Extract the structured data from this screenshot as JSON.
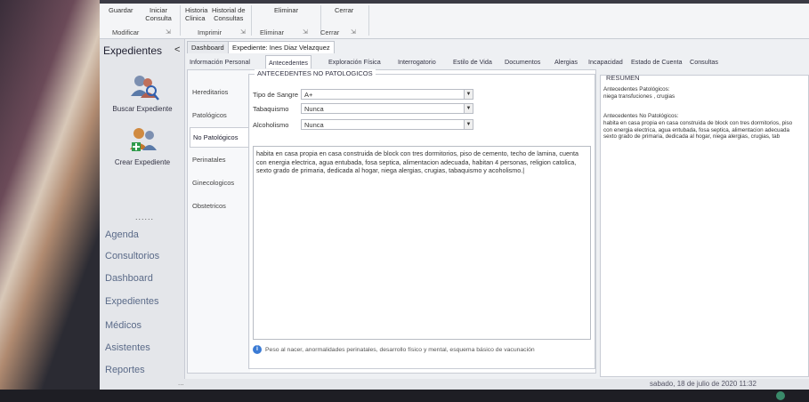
{
  "ribbon": {
    "buttons": [
      {
        "label": "Guardar"
      },
      {
        "label": "Iniciar\nConsulta"
      },
      {
        "label": "Historia\nClinica"
      },
      {
        "label": "Historial de\nConsultas"
      },
      {
        "label": "Eliminar"
      },
      {
        "label": "Cerrar"
      }
    ],
    "group_labels": [
      "Modificar",
      "Imprimir",
      "Eliminar",
      "Cerrar"
    ]
  },
  "sidebar": {
    "title": "Expedientes",
    "collapse_glyph": "<",
    "actions": [
      {
        "label": "Buscar Expediente",
        "icon": "search-users-icon"
      },
      {
        "label": "Crear Expediente",
        "icon": "add-user-icon"
      }
    ],
    "dots": "......",
    "nav": [
      "Agenda",
      "Consultorios",
      "Dashboard",
      "Expedientes",
      "Médicos",
      "Asistentes",
      "Reportes"
    ]
  },
  "doc_tabs": [
    "Dashboard",
    "Expediente: Ines Diaz Velazquez"
  ],
  "sub_tabs": [
    "Información Personal",
    "Antecedentes",
    "Exploración Física",
    "Interrogatorio",
    "Estilo de Vida",
    "Documentos",
    "Alergias",
    "Incapacidad",
    "Estado de Cuenta",
    "Consultas"
  ],
  "sections": [
    "Hereditarios",
    "Patológicos",
    "No Patológicos",
    "Perinatales",
    "Ginecologicos",
    "Obstetricos"
  ],
  "form": {
    "group_title": "ANTECEDENTES NO PATOLOGICOS",
    "fields": [
      {
        "label": "Tipo de Sangre",
        "value": "A+"
      },
      {
        "label": "Tabaquismo",
        "value": "Nunca"
      },
      {
        "label": "Alcoholismo",
        "value": "Nunca"
      }
    ],
    "notes": "habita en casa propia en casa construida de block con tres dormitorios, piso de cemento, techo de lamina, cuenta con energia electrica, agua entubada, fosa septica, alimentacion adecuada, habitan 4 personas, religion catolica, sexto grado de primaria, dedicada al hogar, niega alergias, crugias, tabaquismo y acoholismo.|",
    "hint": "Peso al nacer, anormalidades perinatales, desarrollo físico y mental, esquema básico de vacunación"
  },
  "resumen": {
    "title": "RESUMEN",
    "text": "Antecedentes Patológicos:\nniega transfuciones , crugias\n\n\nAntecedentes No Patológicos:\nhabita en casa propia en casa construida de block con tres dormitorios, piso\ncon energia electrica, agua entubada, fosa septica, alimentacion adecuada\nsexto grado de primaria, dedicada al hogar, niega alergias, crugias, tab"
  },
  "status": {
    "dots": "...",
    "date": "sabado, 18 de julio de 2020   11:32"
  }
}
